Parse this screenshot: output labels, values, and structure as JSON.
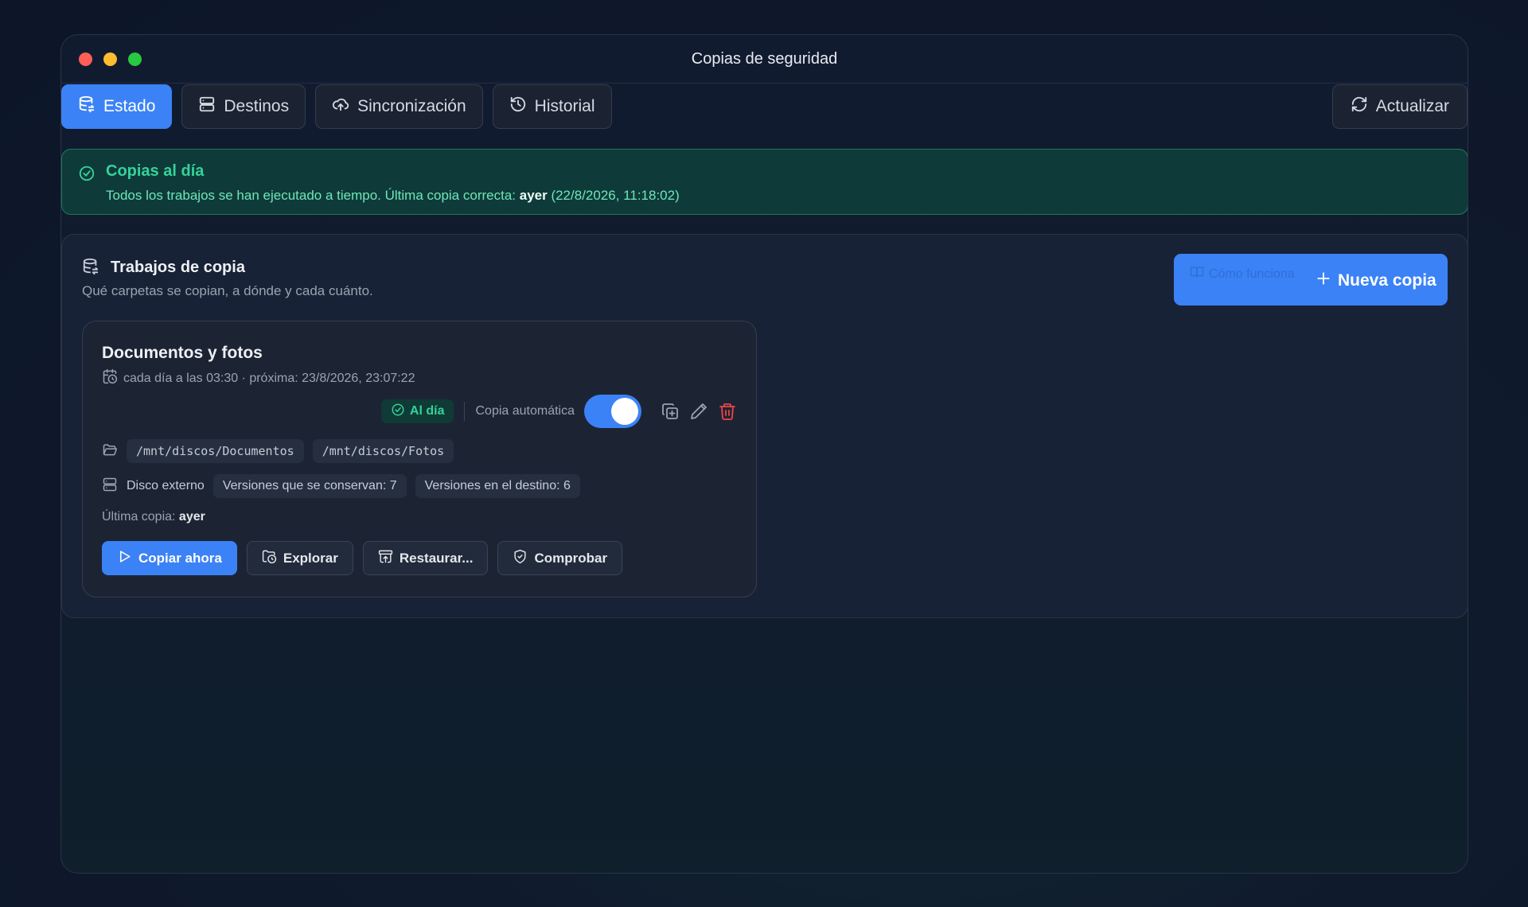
{
  "window": {
    "title": "Copias de seguridad"
  },
  "tabs": [
    {
      "label": "Estado",
      "icon": "database-sync-icon",
      "active": true
    },
    {
      "label": "Destinos",
      "icon": "server-icon",
      "active": false
    },
    {
      "label": "Sincronización",
      "icon": "cloud-upload-icon",
      "active": false
    },
    {
      "label": "Historial",
      "icon": "history-icon",
      "active": false
    }
  ],
  "refresh_label": "Actualizar",
  "banner": {
    "title": "Copias al día",
    "text_prefix": "Todos los trabajos se han ejecutado a tiempo. Última copia correcta: ",
    "text_bold": "ayer",
    "text_suffix": " (22/8/2026, 11:18:02)"
  },
  "panel": {
    "title": "Trabajos de copia",
    "subtitle": "Qué carpetas se copian, a dónde y cada cuánto.",
    "how_label": "Cómo funciona",
    "new_label": "Nueva copia"
  },
  "job": {
    "title": "Documentos y fotos",
    "schedule": "cada día a las 03:30 · próxima: 23/8/2026, 23:07:22",
    "status": "Al día",
    "auto_label": "Copia automática",
    "auto_enabled": true,
    "sources": [
      "/mnt/discos/Documentos",
      "/mnt/discos/Fotos"
    ],
    "destination": "Disco externo",
    "kept_versions": "Versiones que se conservan: 7",
    "dest_versions": "Versiones en el destino: 6",
    "last_label": "Última copia: ",
    "last_value": "ayer",
    "actions": {
      "copy_now": "Copiar ahora",
      "explore": "Explorar",
      "restore": "Restaurar...",
      "verify": "Comprobar"
    }
  },
  "colors": {
    "accent": "#3b82f6",
    "success": "#34d399",
    "danger": "#ef4444"
  }
}
